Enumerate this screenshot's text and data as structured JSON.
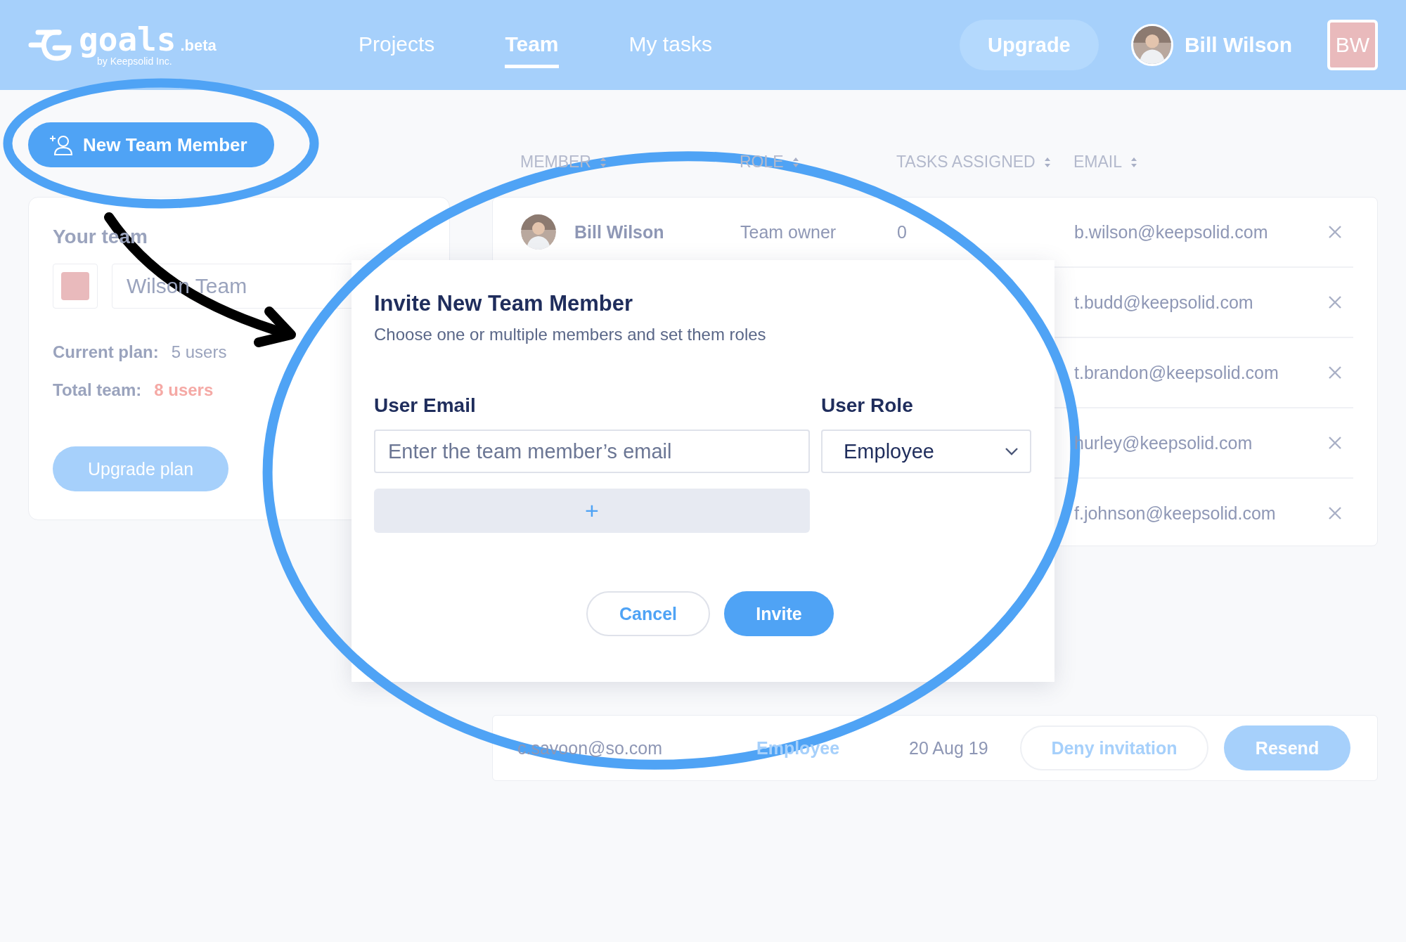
{
  "header": {
    "logo": {
      "name": "goals",
      "tag": ".beta",
      "byline": "by Keepsolid Inc."
    },
    "nav": [
      {
        "label": "Projects",
        "selected": false
      },
      {
        "label": "Team",
        "selected": true
      },
      {
        "label": "My tasks",
        "selected": false
      }
    ],
    "upgrade_button": "Upgrade",
    "user": {
      "name": "Bill Wilson",
      "initials": "BW"
    }
  },
  "new_member_button": "New Team Member",
  "team_card": {
    "title": "Your team",
    "team_name": "Wilson Team",
    "current_plan": {
      "label": "Current plan:",
      "value": "5 users"
    },
    "total_team": {
      "label": "Total team:",
      "value": "8 users"
    },
    "upgrade_plan_button": "Upgrade plan"
  },
  "members_table": {
    "columns": [
      "MEMBER",
      "ROLE",
      "TASKS ASSIGNED",
      "EMAIL"
    ],
    "rows": [
      {
        "member": "Bill Wilson",
        "role": "Team owner",
        "tasks": "0",
        "email": "b.wilson@keepsolid.com"
      },
      {
        "email": "t.budd@keepsolid.com"
      },
      {
        "email": "t.brandon@keepsolid.com"
      },
      {
        "email": "hurley@keepsolid.com"
      },
      {
        "email": "f.johnson@keepsolid.com"
      }
    ]
  },
  "invitations_table": {
    "rows": [
      {
        "email": "c.savoon@so.com",
        "role": "Employee",
        "sent_on": "20 Aug 19",
        "actions": [
          {
            "label": "Deny invitation",
            "kind": "secondary"
          },
          {
            "label": "Resend",
            "kind": "primary"
          }
        ]
      }
    ]
  },
  "modal": {
    "title": "Invite New Team Member",
    "subtitle": "Choose one or multiple members and set them roles",
    "email_label": "User Email",
    "email_placeholder": "Enter the team member’s email",
    "role_label": "User Role",
    "role_value": "Employee",
    "add_button": "+",
    "buttons": [
      {
        "label": "Cancel",
        "kind": "secondary"
      },
      {
        "label": "Invite",
        "kind": "primary"
      }
    ]
  }
}
